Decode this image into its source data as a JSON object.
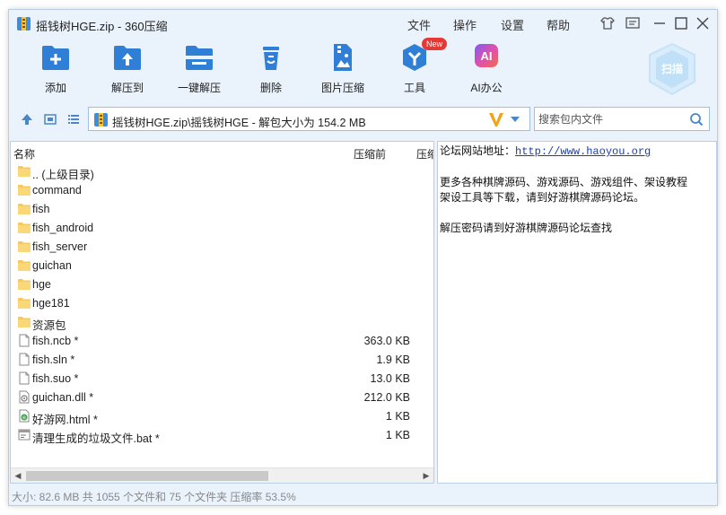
{
  "window": {
    "title": "摇钱树HGE.zip - 360压缩",
    "menu": [
      "文件",
      "操作",
      "设置",
      "帮助"
    ]
  },
  "toolbar": {
    "items": [
      {
        "label": "添加",
        "icon": "add-icon"
      },
      {
        "label": "解压到",
        "icon": "extract-to-icon"
      },
      {
        "label": "一键解压",
        "icon": "one-click-extract-icon"
      },
      {
        "label": "删除",
        "icon": "delete-icon"
      },
      {
        "label": "图片压缩",
        "icon": "image-compress-icon"
      },
      {
        "label": "工具",
        "icon": "tools-icon",
        "badge": "New"
      },
      {
        "label": "AI办公",
        "icon": "ai-office-icon"
      }
    ],
    "scan_label": "扫描"
  },
  "address": {
    "path": "摇钱树HGE.zip\\摇钱树HGE - 解包大小为 154.2 MB"
  },
  "search": {
    "placeholder": "搜索包内文件"
  },
  "filelist": {
    "columns": [
      "名称",
      "压缩前",
      "压缩"
    ],
    "rows": [
      {
        "name": ".. (上级目录)",
        "size": "",
        "type": "folder"
      },
      {
        "name": "command",
        "size": "",
        "type": "folder"
      },
      {
        "name": "fish",
        "size": "",
        "type": "folder"
      },
      {
        "name": "fish_android",
        "size": "",
        "type": "folder"
      },
      {
        "name": "fish_server",
        "size": "",
        "type": "folder"
      },
      {
        "name": "guichan",
        "size": "",
        "type": "folder"
      },
      {
        "name": "hge",
        "size": "",
        "type": "folder"
      },
      {
        "name": "hge181",
        "size": "",
        "type": "folder"
      },
      {
        "name": "资源包",
        "size": "",
        "type": "folder"
      },
      {
        "name": "fish.ncb *",
        "size": "363.0 KB",
        "type": "file"
      },
      {
        "name": "fish.sln *",
        "size": "1.9 KB",
        "type": "file"
      },
      {
        "name": "fish.suo *",
        "size": "13.0 KB",
        "type": "file"
      },
      {
        "name": "guichan.dll *",
        "size": "212.0 KB",
        "type": "dll"
      },
      {
        "name": "好游网.html *",
        "size": "1 KB",
        "type": "html"
      },
      {
        "name": "清理生成的垃圾文件.bat *",
        "size": "1 KB",
        "type": "bat"
      }
    ]
  },
  "comment": {
    "line1_prefix": "论坛网站地址：",
    "line1_link": "http://www.haoyou.org",
    "line2": "更多各种棋牌源码、游戏源码、游戏组件、架设教程",
    "line3": "架设工具等下载，请到好游棋牌源码论坛。",
    "line4": "解压密码请到好游棋牌源码论坛查找"
  },
  "status": {
    "text": "大小: 82.6 MB 共 1055 个文件和 75 个文件夹 压缩率 53.5%"
  },
  "colors": {
    "accent": "#2f7fd6",
    "window_bg": "#eaf3fc",
    "folder": "#f7c95a"
  }
}
